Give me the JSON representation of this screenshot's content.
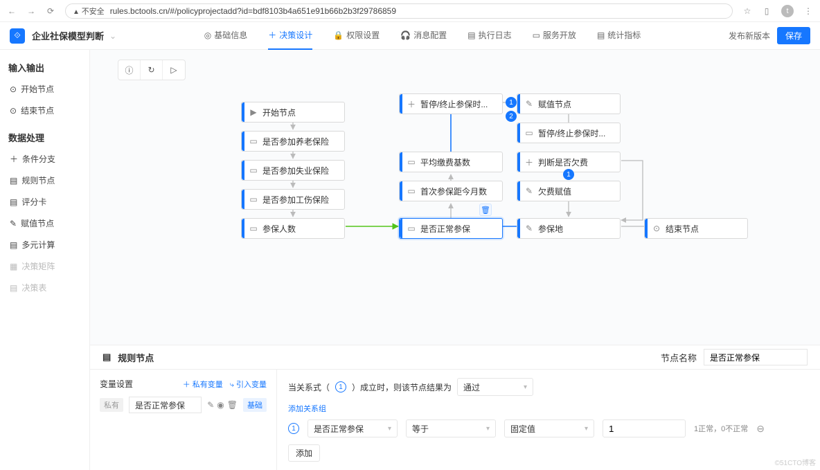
{
  "browser": {
    "unsafe": "不安全",
    "url": "rules.bctools.cn/#/policyprojectadd?id=bdf8103b4a651e91b66b2b3f29786859",
    "avatar": "t"
  },
  "header": {
    "logo": "⟐",
    "title": "企业社保模型判断",
    "nav": [
      {
        "icon": "◎",
        "label": "基础信息"
      },
      {
        "icon": "＋",
        "label": "决策设计",
        "active": true
      },
      {
        "icon": "🔒",
        "label": "权限设置"
      },
      {
        "icon": "🎧",
        "label": "消息配置"
      },
      {
        "icon": "▤",
        "label": "执行日志"
      },
      {
        "icon": "▭",
        "label": "服务开放"
      },
      {
        "icon": "▤",
        "label": "统计指标"
      }
    ],
    "publish": "发布新版本",
    "save": "保存"
  },
  "sidebar": {
    "group1": "输入输出",
    "items1": [
      {
        "icon": "⊙",
        "label": "开始节点"
      },
      {
        "icon": "⊙",
        "label": "结束节点"
      }
    ],
    "group2": "数据处理",
    "items2": [
      {
        "icon": "＋",
        "label": "条件分支"
      },
      {
        "icon": "▤",
        "label": "规则节点"
      },
      {
        "icon": "▤",
        "label": "评分卡"
      },
      {
        "icon": "✎",
        "label": "赋值节点"
      },
      {
        "icon": "▤",
        "label": "多元计算"
      },
      {
        "icon": "▦",
        "label": "决策矩阵",
        "disabled": true
      },
      {
        "icon": "▤",
        "label": "决策表",
        "disabled": true
      }
    ]
  },
  "toolbar": {
    "i1": "ⓘ",
    "i2": "↻",
    "i3": "▷"
  },
  "nodes": {
    "c1": {
      "icon": "▶",
      "label": "开始节点"
    },
    "c2": {
      "icon": "▭",
      "label": "是否参加养老保险"
    },
    "c3": {
      "icon": "▭",
      "label": "是否参加失业保险"
    },
    "c4": {
      "icon": "▭",
      "label": "是否参加工伤保险"
    },
    "c5": {
      "icon": "▭",
      "label": "参保人数"
    },
    "m1": {
      "icon": "＋",
      "label": "暂停/终止参保时..."
    },
    "m2": {
      "icon": "▭",
      "label": "平均缴费基数"
    },
    "m3": {
      "icon": "▭",
      "label": "首次参保距今月数"
    },
    "m4": {
      "icon": "▭",
      "label": "是否正常参保"
    },
    "r1": {
      "icon": "✎",
      "label": "赋值节点"
    },
    "r2": {
      "icon": "▭",
      "label": "暂停/终止参保时..."
    },
    "r3": {
      "icon": "＋",
      "label": "判断是否欠费"
    },
    "r4": {
      "icon": "✎",
      "label": "欠费赋值"
    },
    "r5": {
      "icon": "✎",
      "label": "参保地"
    },
    "r6": {
      "icon": "⊙",
      "label": "结束节点"
    }
  },
  "badges": {
    "b1": "1",
    "b2": "2",
    "b3": "1"
  },
  "panel": {
    "sectionIcon": "▤",
    "sectionTitle": "规则节点",
    "nodeNameLabel": "节点名称",
    "nodeNameValue": "是否正常参保",
    "varTitle": "变量设置",
    "linkPrivate": "＋ 私有变量",
    "linkImport": "⤷ 引入变量",
    "tagPrivate": "私有",
    "varName": "是否正常参保",
    "tagBase": "基础",
    "relationPrefix": "当关系式（",
    "relationNum": "1",
    "relationSuffix": "）成立时，则该节点结果为",
    "resultSel": "通过",
    "addGroup": "添加关系组",
    "condVar": "是否正常参保",
    "condOp": "等于",
    "condType": "固定值",
    "condVal": "1",
    "condNote": "1正常，0不正常",
    "addBtn": "添加"
  },
  "watermark": "©51CTO博客"
}
